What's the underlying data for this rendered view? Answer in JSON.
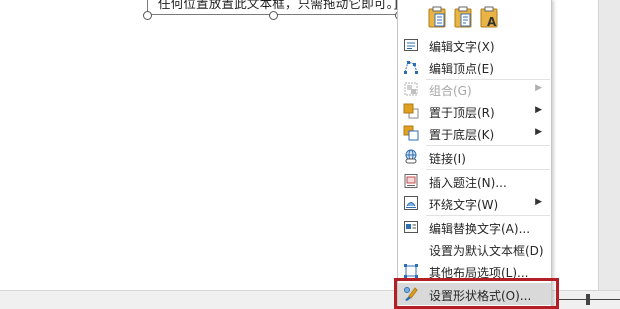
{
  "document": {
    "textbox_text": "任何位置放置此文本框，只需拖动它即可。]"
  },
  "context_menu": {
    "paste_options": [
      "paste-keep-source-icon",
      "paste-merge-icon",
      "paste-text-only-icon"
    ],
    "items": [
      {
        "label": "编辑文字(X)",
        "icon": "edit-text-icon"
      },
      {
        "label": "编辑顶点(E)",
        "icon": "edit-points-icon"
      },
      {
        "label": "组合(G)",
        "icon": "group-icon",
        "disabled": true,
        "submenu": true
      },
      {
        "label": "置于顶层(R)",
        "icon": "bring-front-icon",
        "submenu": true
      },
      {
        "label": "置于底层(K)",
        "icon": "send-back-icon",
        "submenu": true
      },
      {
        "label": "链接(I)",
        "icon": "link-icon"
      },
      {
        "label": "插入题注(N)...",
        "icon": "caption-icon"
      },
      {
        "label": "环绕文字(W)",
        "icon": "wrap-text-icon",
        "submenu": true
      },
      {
        "label": "编辑替换文字(A)...",
        "icon": "alt-text-icon"
      },
      {
        "label": "设置为默认文本框(D)",
        "icon": ""
      },
      {
        "label": "其他布局选项(L)...",
        "icon": "layout-options-icon"
      },
      {
        "label": "设置形状格式(O)...",
        "icon": "format-shape-icon",
        "highlighted": true
      }
    ]
  },
  "colors": {
    "highlight_border": "#b21f24",
    "icon_blue": "#2e6db4",
    "icon_orange": "#e0a020"
  }
}
